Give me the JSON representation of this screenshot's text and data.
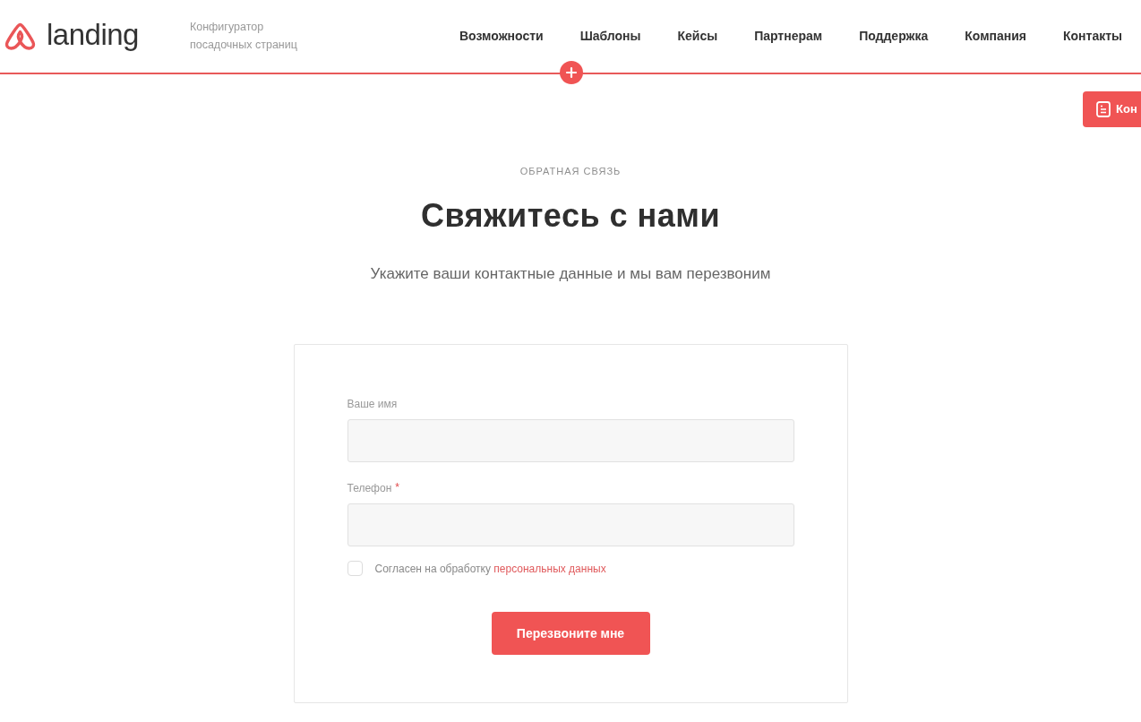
{
  "header": {
    "logo": {
      "text": "landing"
    },
    "tagline": "Конфигуратор посадочных страниц",
    "nav": [
      {
        "label": "Возможности"
      },
      {
        "label": "Шаблоны"
      },
      {
        "label": "Кейсы"
      },
      {
        "label": "Партнерам"
      },
      {
        "label": "Поддержка"
      },
      {
        "label": "Компания"
      },
      {
        "label": "Контакты"
      }
    ]
  },
  "floating_button": {
    "label": "Кон"
  },
  "section": {
    "eyebrow": "ОБРАТНАЯ СВЯЗЬ",
    "title": "Свяжитесь с нами",
    "subtitle": "Укажите ваши контактные данные и мы вам перезвоним"
  },
  "form": {
    "fields": [
      {
        "label": "Ваше имя"
      },
      {
        "label": "Телефон",
        "required_mark": "*"
      }
    ],
    "consent": {
      "checked": false,
      "text": "Согласен на обработку",
      "link": "персональных данных"
    },
    "submit": "Перезвоните мне"
  }
}
